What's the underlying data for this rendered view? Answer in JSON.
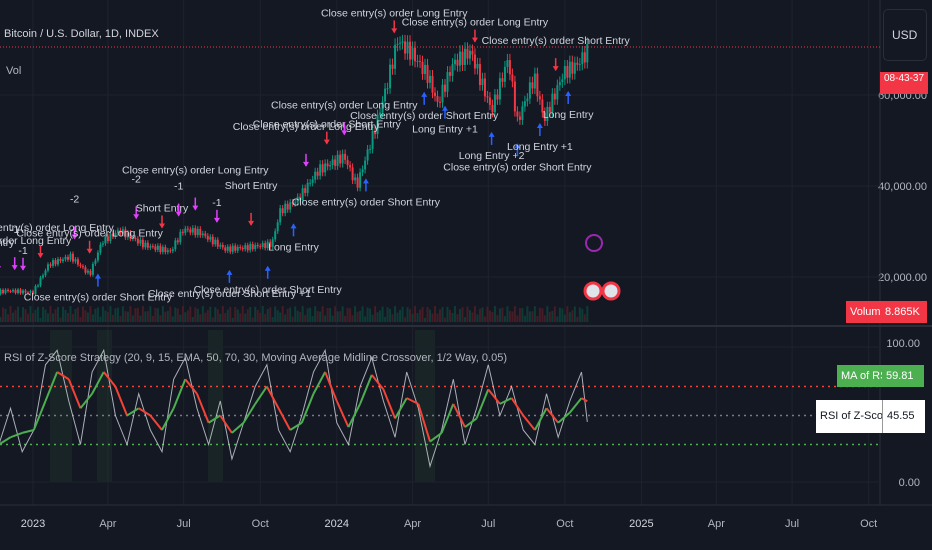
{
  "header": {
    "symbol_title": "Bitcoin / U.S. Dollar, 1D, INDEX",
    "vol_label": "Vol",
    "currency_button": "USD",
    "countdown": "08-43-37"
  },
  "volume_tag": {
    "label": "Volume",
    "value": "8.865K",
    "color": "#f23645"
  },
  "indicator": {
    "title": "RSI of Z-Score Strategy (20, 9, 15, EMA, 50, 70, 30, Moving Average Midline Crossover, 1/2 Way, 0.05)",
    "ma_label": "MA of RSI",
    "ma_value": "59.81",
    "rsi_label": "RSI of Z-Score",
    "rsi_value": "45.55"
  },
  "colors": {
    "background": "#141823",
    "bull": "#089981",
    "bear": "#f23645",
    "long_arrow": "#2962ff",
    "short_arrow": "#f23645",
    "close_marker": "#e040fb",
    "rsi_up": "#4caf50",
    "rsi_down": "#f44336",
    "rsi_line": "#d1d4dc",
    "overbought": "#f44336",
    "oversold": "#4caf50",
    "midline": "#787b86"
  },
  "chart_data": [
    {
      "type": "candlestick",
      "title": "Bitcoin / U.S. Dollar, 1D, INDEX",
      "ylabel": "USD",
      "ylim": [
        0,
        75000
      ],
      "y_ticks": [
        "20,000.00",
        "40,000.00",
        "60,000.00"
      ],
      "x_ticks": [
        "2023",
        "Apr",
        "Jul",
        "Oct",
        "2024",
        "Apr",
        "Jul",
        "Oct",
        "2025",
        "Apr",
        "Jul",
        "Oct"
      ],
      "grid": true,
      "close_series": {
        "dates": [
          "2022-10-15",
          "2022-11-01",
          "2022-11-15",
          "2022-12-01",
          "2023-01-01",
          "2023-01-20",
          "2023-02-15",
          "2023-03-10",
          "2023-03-25",
          "2023-04-15",
          "2023-05-15",
          "2023-06-15",
          "2023-07-01",
          "2023-07-20",
          "2023-08-20",
          "2023-09-15",
          "2023-10-15",
          "2023-10-25",
          "2023-11-15",
          "2023-12-10",
          "2024-01-10",
          "2024-01-25",
          "2024-02-15",
          "2024-03-01",
          "2024-03-14",
          "2024-04-01",
          "2024-04-20",
          "2024-05-01",
          "2024-05-20",
          "2024-06-10",
          "2024-07-05",
          "2024-07-25",
          "2024-08-05",
          "2024-08-25",
          "2024-09-06",
          "2024-09-30",
          "2024-10-15",
          "2024-10-28"
        ],
        "values": [
          19200,
          20500,
          16500,
          17000,
          16600,
          22800,
          24500,
          20500,
          27800,
          30200,
          27000,
          25600,
          30500,
          29800,
          26100,
          26500,
          27200,
          34500,
          37000,
          43500,
          46500,
          40000,
          52000,
          62000,
          72000,
          69000,
          64000,
          58000,
          67000,
          69500,
          56500,
          68000,
          54000,
          64000,
          54500,
          65000,
          66500,
          69500
        ]
      },
      "volume": "8.865K",
      "trade_markers": [
        {
          "date": "2022-11-08",
          "kind": "short",
          "text": "Short Entry"
        },
        {
          "date": "2022-11-20",
          "kind": "close",
          "text": "Close entry(s) order Long Entry"
        },
        {
          "date": "2022-12-10",
          "kind": "close",
          "text": "-1"
        },
        {
          "date": "2022-12-20",
          "kind": "close",
          "text": "-1"
        },
        {
          "date": "2023-01-10",
          "kind": "short",
          "text": "Close entry(s) order Long Entry"
        },
        {
          "date": "2023-02-20",
          "kind": "close",
          "text": "-2"
        },
        {
          "date": "2023-03-10",
          "kind": "short",
          "text": "Close entry(s) order Long Entry"
        },
        {
          "date": "2023-03-20",
          "kind": "long",
          "text": "Close entry(s) order Short Entry"
        },
        {
          "date": "2023-05-05",
          "kind": "close",
          "text": "-2"
        },
        {
          "date": "2023-06-05",
          "kind": "short",
          "text": "Short Entry"
        },
        {
          "date": "2023-06-25",
          "kind": "close",
          "text": "-1"
        },
        {
          "date": "2023-07-15",
          "kind": "close",
          "text": "Close entry(s) order Long Entry"
        },
        {
          "date": "2023-08-10",
          "kind": "close",
          "text": "-1"
        },
        {
          "date": "2023-08-25",
          "kind": "long",
          "text": "Close entry(s) order Short Entry +1"
        },
        {
          "date": "2023-09-20",
          "kind": "short",
          "text": "Short Entry"
        },
        {
          "date": "2023-10-10",
          "kind": "long",
          "text": "Close entry(s) order Short Entry"
        },
        {
          "date": "2023-11-10",
          "kind": "long",
          "text": "Long Entry"
        },
        {
          "date": "2023-11-25",
          "kind": "close",
          "text": "Close entry(s) order Long Entry"
        },
        {
          "date": "2023-12-20",
          "kind": "short",
          "text": "Close entry(s) order Short Entry"
        },
        {
          "date": "2024-01-10",
          "kind": "close",
          "text": "Close entry(s) order Long Entry"
        },
        {
          "date": "2024-02-05",
          "kind": "long",
          "text": "Close entry(s) order Short Entry"
        },
        {
          "date": "2024-03-10",
          "kind": "short",
          "text": "Close entry(s) order Long Entry"
        },
        {
          "date": "2024-04-15",
          "kind": "long",
          "text": "Close entry(s) order Short Entry"
        },
        {
          "date": "2024-05-10",
          "kind": "long",
          "text": "Long Entry +1"
        },
        {
          "date": "2024-06-15",
          "kind": "short",
          "text": "Close entry(s) order Long Entry"
        },
        {
          "date": "2024-07-05",
          "kind": "long",
          "text": "Long Entry +2"
        },
        {
          "date": "2024-08-05",
          "kind": "long",
          "text": "Close entry(s) order Short Entry"
        },
        {
          "date": "2024-09-01",
          "kind": "long",
          "text": "Long Entry +1"
        },
        {
          "date": "2024-09-20",
          "kind": "short",
          "text": "Close entry(s) order Short Entry"
        },
        {
          "date": "2024-10-05",
          "kind": "long",
          "text": "Long Entry"
        }
      ]
    },
    {
      "type": "line",
      "title": "RSI of Z-Score Strategy",
      "ylim": [
        0,
        100
      ],
      "y_ticks": [
        "100.00",
        "0.00"
      ],
      "levels": {
        "overbought": 70,
        "midline": 50,
        "oversold": 30
      },
      "x": [
        "2022-10-10",
        "2022-10-24",
        "2022-11-07",
        "2022-11-21",
        "2022-12-05",
        "2022-12-19",
        "2023-01-02",
        "2023-01-16",
        "2023-01-30",
        "2023-02-13",
        "2023-02-27",
        "2023-03-13",
        "2023-03-27",
        "2023-04-10",
        "2023-04-24",
        "2023-05-08",
        "2023-05-22",
        "2023-06-05",
        "2023-06-19",
        "2023-07-03",
        "2023-07-17",
        "2023-07-31",
        "2023-08-14",
        "2023-08-28",
        "2023-09-11",
        "2023-09-25",
        "2023-10-09",
        "2023-10-23",
        "2023-11-06",
        "2023-11-20",
        "2023-12-04",
        "2023-12-18",
        "2024-01-01",
        "2024-01-15",
        "2024-01-29",
        "2024-02-12",
        "2024-02-26",
        "2024-03-11",
        "2024-03-25",
        "2024-04-08",
        "2024-04-22",
        "2024-05-06",
        "2024-05-20",
        "2024-06-03",
        "2024-06-17",
        "2024-07-01",
        "2024-07-15",
        "2024-07-29",
        "2024-08-12",
        "2024-08-26",
        "2024-09-09",
        "2024-09-23",
        "2024-10-07",
        "2024-10-21",
        "2024-10-28"
      ],
      "series": [
        {
          "name": "RSI of Z-Score",
          "values": [
            20,
            45,
            15,
            30,
            55,
            25,
            40,
            85,
            95,
            60,
            30,
            80,
            95,
            50,
            30,
            65,
            40,
            25,
            75,
            90,
            55,
            30,
            60,
            20,
            45,
            70,
            85,
            40,
            25,
            50,
            80,
            95,
            45,
            30,
            70,
            90,
            60,
            35,
            80,
            55,
            15,
            40,
            75,
            30,
            55,
            85,
            50,
            70,
            40,
            30,
            65,
            35,
            60,
            80,
            45.55
          ]
        },
        {
          "name": "MA of RSI",
          "values": [
            30,
            32,
            28,
            30,
            35,
            38,
            40,
            60,
            80,
            75,
            55,
            65,
            80,
            70,
            50,
            55,
            50,
            40,
            55,
            75,
            65,
            45,
            50,
            38,
            45,
            58,
            70,
            55,
            40,
            45,
            65,
            80,
            60,
            42,
            58,
            78,
            68,
            48,
            62,
            58,
            32,
            38,
            58,
            42,
            48,
            68,
            58,
            62,
            50,
            40,
            55,
            45,
            52,
            62,
            59.81
          ]
        }
      ]
    }
  ]
}
